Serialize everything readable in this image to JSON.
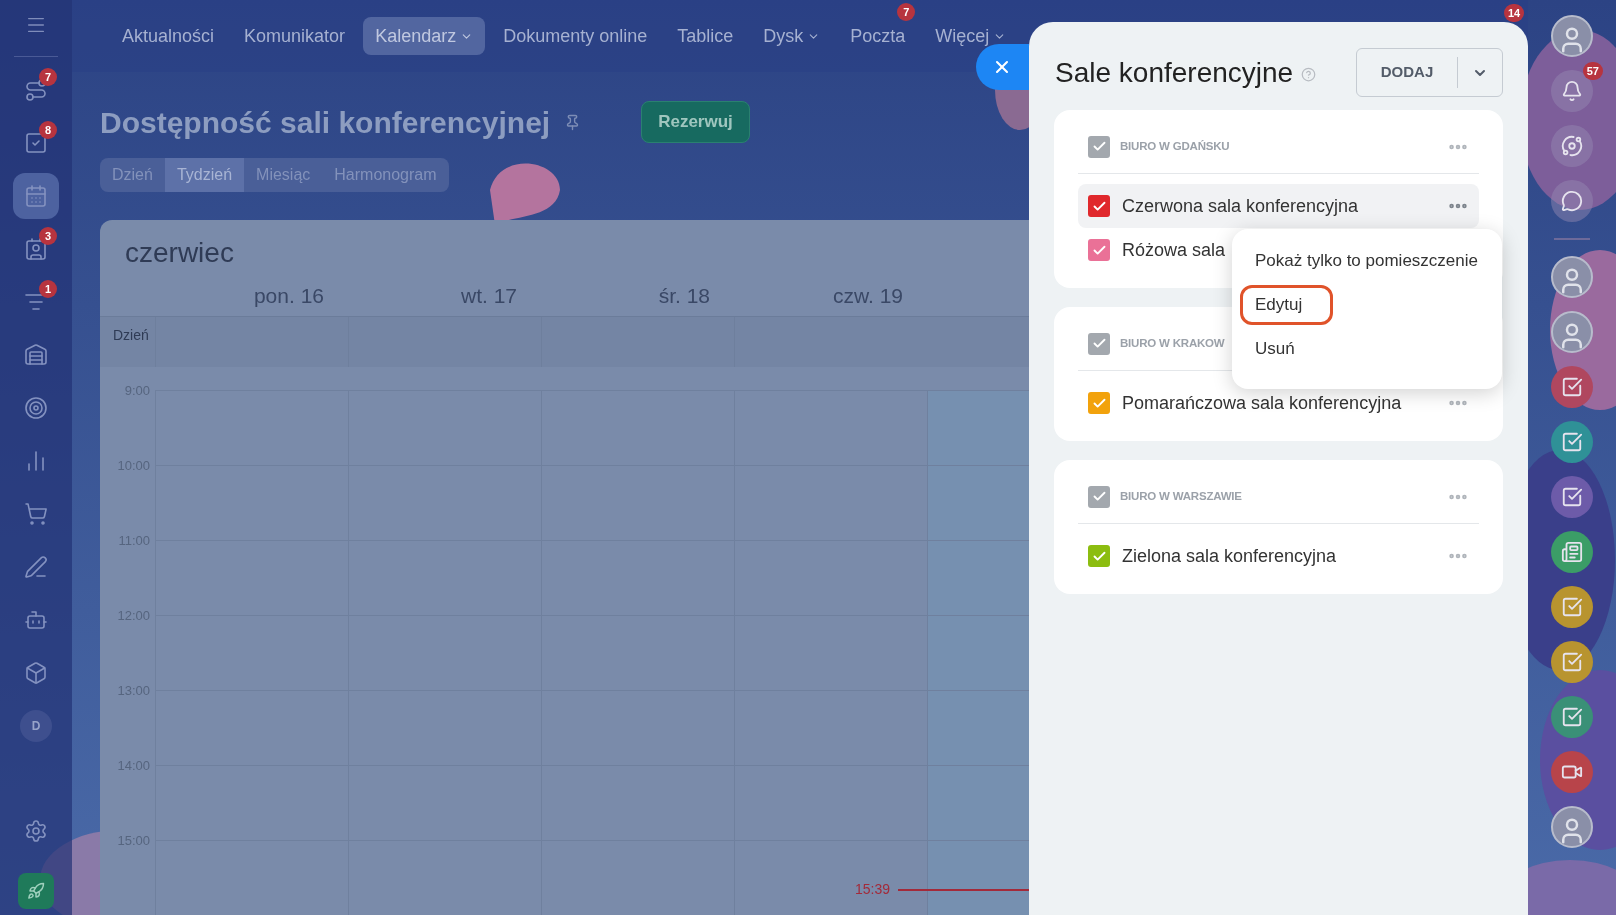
{
  "left_sidebar": {
    "items": [
      {
        "kind": "icon",
        "badge": "7",
        "selected": false
      },
      {
        "kind": "icon",
        "badge": "8",
        "selected": false
      },
      {
        "kind": "icon",
        "selected": true
      },
      {
        "kind": "icon",
        "badge": "3",
        "selected": false
      },
      {
        "kind": "icon",
        "badge": "1",
        "selected": false
      },
      {
        "kind": "icon",
        "selected": false
      },
      {
        "kind": "icon",
        "selected": false
      },
      {
        "kind": "icon",
        "selected": false
      },
      {
        "kind": "icon",
        "selected": false
      },
      {
        "kind": "icon",
        "selected": false
      },
      {
        "kind": "icon",
        "selected": false
      },
      {
        "kind": "icon",
        "selected": false
      },
      {
        "kind": "avatar",
        "letter": "D",
        "selected": false
      }
    ]
  },
  "top_nav": {
    "items": [
      {
        "label": "Aktualności",
        "selected": false,
        "dropdown": false
      },
      {
        "label": "Komunikator",
        "selected": false,
        "dropdown": false
      },
      {
        "label": "Kalendarz",
        "selected": true,
        "dropdown": true
      },
      {
        "label": "Dokumenty online",
        "selected": false,
        "dropdown": false
      },
      {
        "label": "Tablice",
        "selected": false,
        "dropdown": false
      },
      {
        "label": "Dysk",
        "selected": false,
        "dropdown": true
      },
      {
        "label": "Poczta",
        "selected": false,
        "dropdown": false,
        "badge": "7"
      },
      {
        "label": "Więcej",
        "selected": false,
        "dropdown": true
      }
    ],
    "corner_badge": "14"
  },
  "page": {
    "title": "Dostępność sali konferencyjnej",
    "action_button": "Rezerwuj"
  },
  "view_tabs": [
    {
      "label": "Dzień",
      "selected": false
    },
    {
      "label": "Tydzień",
      "selected": true
    },
    {
      "label": "Miesiąc",
      "selected": false
    },
    {
      "label": "Harmonogram",
      "selected": false
    }
  ],
  "calendar": {
    "month": "czerwiec",
    "days": [
      "pon. 16",
      "wt. 17",
      "śr. 18",
      "czw. 19"
    ],
    "all_day_label": "Dzień",
    "hours": [
      "9:00",
      "10:00",
      "11:00",
      "12:00",
      "13:00",
      "14:00",
      "15:00"
    ],
    "current_time": "15:39"
  },
  "panel": {
    "title": "Sale konferencyjne",
    "add_button": "DODAJ",
    "groups": [
      {
        "name": "BIURO W GDAŃSKU",
        "checked": true,
        "color": "#a3a8ae",
        "more_button": true,
        "rooms": [
          {
            "name": "Czerwona sala konferencyjna",
            "checked": true,
            "color": "#e0282c",
            "selected": true,
            "more_button": true
          },
          {
            "name": "Różowa sala",
            "checked": true,
            "color": "#ea7197",
            "selected": false,
            "more_button": false
          }
        ]
      },
      {
        "name": "BIURO W KRAKOW",
        "checked": true,
        "color": "#a3a8ae",
        "more_button": false,
        "rooms": [
          {
            "name": "Pomarańczowa sala konferencyjna",
            "checked": true,
            "color": "#f2a20c",
            "selected": false,
            "more_button": true
          }
        ]
      },
      {
        "name": "BIURO W WARSZAWIE",
        "checked": true,
        "color": "#a3a8ae",
        "more_button": true,
        "rooms": [
          {
            "name": "Zielona sala konferencyjna",
            "checked": true,
            "color": "#8cbd10",
            "selected": false,
            "more_button": true
          }
        ]
      }
    ],
    "context_menu": {
      "items": [
        {
          "label": "Pokaż tylko to pomieszczenie",
          "highlighted": false
        },
        {
          "label": "Edytuj",
          "highlighted": true
        },
        {
          "label": "Usuń",
          "highlighted": false
        }
      ]
    }
  },
  "right_sidebar": {
    "items": [
      {
        "kind": "avatar"
      },
      {
        "kind": "bell",
        "badge": "57"
      },
      {
        "kind": "copilot"
      },
      {
        "kind": "chat"
      },
      {
        "kind": "divider"
      },
      {
        "kind": "avatar"
      },
      {
        "kind": "avatar"
      },
      {
        "kind": "task",
        "color": "#b0475f"
      },
      {
        "kind": "task",
        "color": "#2f9197"
      },
      {
        "kind": "task",
        "color": "#6d5ba9"
      },
      {
        "kind": "news",
        "color": "#3b9d67"
      },
      {
        "kind": "task",
        "color": "#b8942f"
      },
      {
        "kind": "task",
        "color": "#b8942f"
      },
      {
        "kind": "task",
        "color": "#3a9077"
      },
      {
        "kind": "video",
        "color": "#b8444a"
      },
      {
        "kind": "avatar"
      }
    ]
  }
}
